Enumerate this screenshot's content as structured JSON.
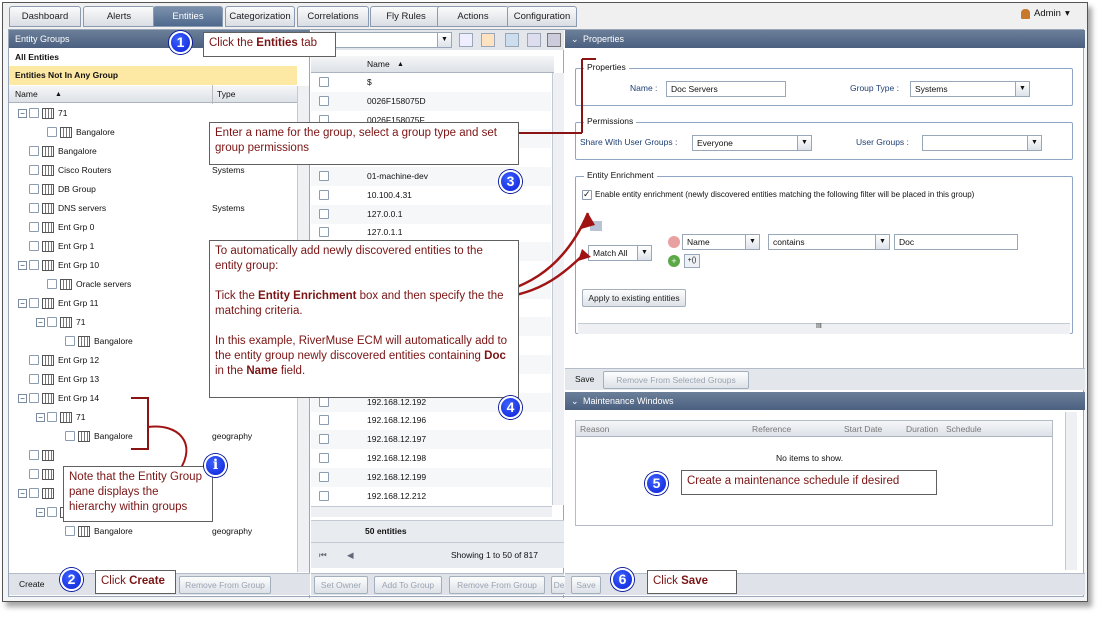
{
  "nav": {
    "tabs": [
      "Dashboard",
      "Alerts",
      "Entities",
      "Categorization",
      "Correlations",
      "Fly Rules",
      "Actions",
      "Configuration"
    ],
    "active": "Entities",
    "user": "Admin"
  },
  "left": {
    "title": "Entity Groups",
    "all": "All Entities",
    "notgroup": "Entities Not In Any Group",
    "col_name": "Name",
    "col_type": "Type",
    "rows": [
      {
        "label": "71",
        "type": ""
      },
      {
        "label": "Bangalore",
        "type": ""
      },
      {
        "label": "Bangalore",
        "type": ""
      },
      {
        "label": "Cisco Routers",
        "type": "Systems"
      },
      {
        "label": "DB Group",
        "type": ""
      },
      {
        "label": "DNS servers",
        "type": "Systems"
      },
      {
        "label": "Ent Grp 0",
        "type": ""
      },
      {
        "label": "Ent Grp 1",
        "type": ""
      },
      {
        "label": "Ent Grp 10",
        "type": ""
      },
      {
        "label": "Oracle servers",
        "type": ""
      },
      {
        "label": "Ent Grp 11",
        "type": ""
      },
      {
        "label": "71",
        "type": ""
      },
      {
        "label": "Bangalore",
        "type": ""
      },
      {
        "label": "Ent Grp 12",
        "type": ""
      },
      {
        "label": "Ent Grp 13",
        "type": ""
      },
      {
        "label": "Ent Grp 14",
        "type": ""
      },
      {
        "label": "71",
        "type": ""
      },
      {
        "label": "Bangalore",
        "type": "geography"
      },
      {
        "label": "",
        "type": ""
      },
      {
        "label": "",
        "type": ""
      },
      {
        "label": "",
        "type": ""
      },
      {
        "label": "71",
        "type": ""
      },
      {
        "label": "Bangalore",
        "type": "geography"
      }
    ],
    "btn_create": "Create",
    "btn_remove": "Remove From Group"
  },
  "mid": {
    "col_name": "Name",
    "rows": [
      "$",
      "0026F158075D",
      "0026F158075F",
      "",
      "",
      "01-machine-dev",
      "10.100.4.31",
      "127.0.0.1",
      "127.0.1.1",
      "",
      "",
      "",
      "",
      "",
      "",
      "",
      "",
      "192.168.12.192",
      "192.168.12.196",
      "192.168.12.197",
      "192.168.12.198",
      "192.168.12.199",
      "192.168.12.212"
    ],
    "count": "50 entities",
    "paging": "Showing 1 to 50 of 817",
    "btns": [
      "Set Owner",
      "Add To Group",
      "Remove From Group",
      "De"
    ]
  },
  "right": {
    "title": "Properties",
    "props": {
      "legend": "Properties",
      "name_label": "Name :",
      "name_value": "Doc Servers",
      "gtype_label": "Group Type :",
      "gtype_value": "Systems"
    },
    "perm": {
      "legend": "Permissions",
      "share_label": "Share With User Groups :",
      "share_value": "Everyone",
      "ug_label": "User Groups :",
      "ug_value": ""
    },
    "enrich": {
      "legend": "Entity Enrichment",
      "check_label": "Enable entity enrichment (newly discovered entities matching the following filter will be placed in this group)",
      "match": "Match All",
      "field": "Name",
      "op": "contains",
      "value": "Doc",
      "apply": "Apply to existing entities",
      "scroll": "III"
    },
    "save": "Save",
    "remove_sel": "Remove From Selected Groups",
    "mw": {
      "title": "Maintenance Windows",
      "cols": [
        "Reason",
        "Reference",
        "Start Date",
        "Duration",
        "Schedule"
      ],
      "empty": "No items to show."
    },
    "bottom_save": "Save"
  },
  "callouts": {
    "c1_pre": "Click the ",
    "c1_b": "Entities",
    "c1_post": " tab",
    "c2_pre": "Click ",
    "c2_b": "Create",
    "c3": "Enter a name for the group, select a group type and set group permissions",
    "c4_l1": "To automatically add newly discovered entities to the entity group:",
    "c4_l2_pre": "Tick the ",
    "c4_l2_b": "Entity Enrichment",
    "c4_l2_post": " box and then specify the the matching criteria.",
    "c4_l3_pre": "In this example, RiverMuse ECM  will automatically add to the entity group newly discovered entities containing ",
    "c4_l3_b1": "Doc",
    "c4_l3_mid": " in the ",
    "c4_l3_b2": "Name",
    "c4_l3_post": " field.",
    "ci": "Note that the Entity Group pane displays the hierarchy within groups",
    "c5": "Create a maintenance schedule if desired",
    "c6_pre": "Click ",
    "c6_b": "Save"
  },
  "badges": [
    "1",
    "2",
    "3",
    "4",
    "5",
    "6",
    "i"
  ]
}
